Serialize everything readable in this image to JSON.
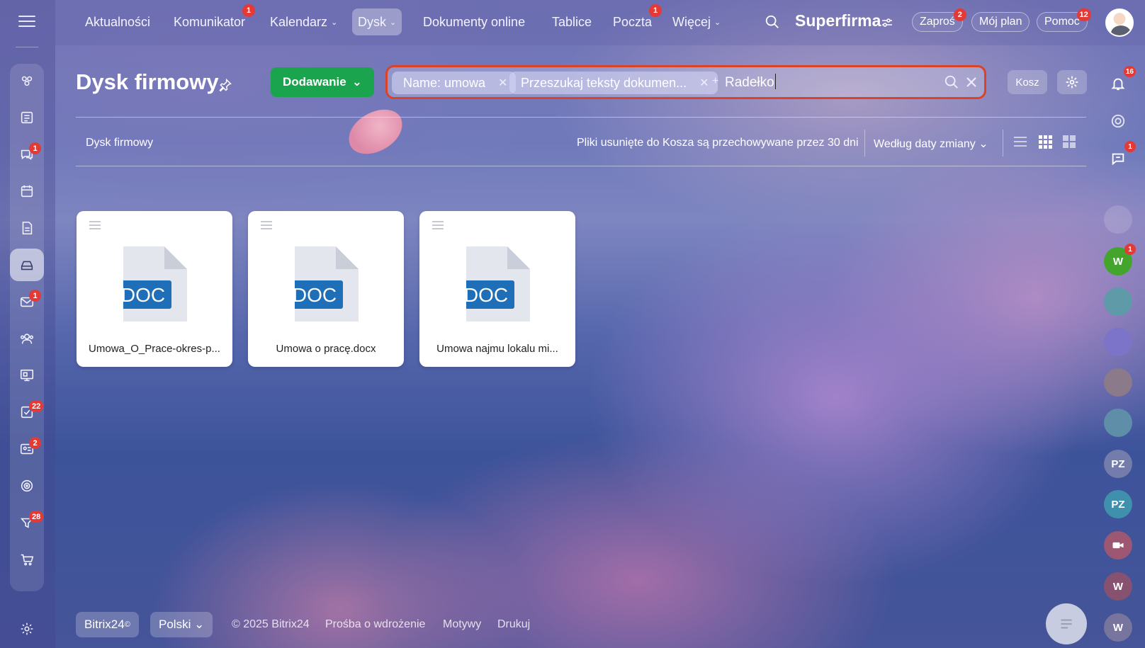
{
  "nav": {
    "items": [
      {
        "label": "Aktualności",
        "badge": ""
      },
      {
        "label": "Komunikator",
        "badge": "1"
      },
      {
        "label": "Kalendarz",
        "badge": "",
        "chevron": "⌄"
      },
      {
        "label": "Dysk",
        "badge": "",
        "chevron": "⌄"
      },
      {
        "label": "Dokumenty online",
        "badge": ""
      },
      {
        "label": "Tablice",
        "badge": ""
      },
      {
        "label": "Poczta",
        "badge": "1"
      },
      {
        "label": "Więcej",
        "badge": "",
        "chevron": "⌄"
      }
    ],
    "brand": "Superfirma",
    "invite_label": "Zaproś",
    "invite_badge": "2",
    "plan_label": "Mój plan",
    "help_label": "Pomoc",
    "help_badge": "12"
  },
  "sidebar": {
    "badges": {
      "chats": "1",
      "mail": "1",
      "tasks": "22",
      "crm": "2",
      "sites": "28"
    }
  },
  "header": {
    "title": "Dysk firmowy",
    "add_button": "Dodawanie",
    "search": {
      "chips": [
        {
          "label": "Name: umowa"
        },
        {
          "label": "Przeszukaj teksty dokumen..."
        }
      ],
      "query": "Radełko"
    },
    "trash_button": "Kosz"
  },
  "toolbar": {
    "breadcrumb": "Dysk firmowy",
    "trash_note": "Pliki usunięte do Kosza są przechowywane przez 30 dni",
    "sort_label": "Według daty zmiany"
  },
  "files": [
    {
      "name": "Umowa_O_Prace-okres-p...",
      "type": "DOC"
    },
    {
      "name": "Umowa o pracę.docx",
      "type": "DOC"
    },
    {
      "name": "Umowa najmu lokalu mi...",
      "type": "DOC"
    }
  ],
  "right_rail": {
    "notifications_badge": "16",
    "chat_badge": "1",
    "users": [
      {
        "initials": "W",
        "badge": "1",
        "color": "#43a52b"
      },
      {
        "initials": "PZ",
        "badge": "",
        "color": "#8a8fb0"
      },
      {
        "initials": "PZ",
        "badge": "",
        "color": "#3f9bb0"
      },
      {
        "initials": "W",
        "badge": "",
        "color": "#c0504d"
      },
      {
        "initials": "W",
        "badge": "",
        "color": "#9a8aa0"
      }
    ]
  },
  "footer": {
    "brand": "Bitrix24",
    "brand_mark": "©",
    "language": "Polski",
    "copyright": "© 2025 Bitrix24",
    "links": [
      "Prośba o wdrożenie",
      "Motywy",
      "Drukuj"
    ]
  },
  "colors": {
    "accent_green": "#1aa44e",
    "badge_red": "#e53935",
    "search_highlight": "#d8442a",
    "doc_blue": "#1e6fb8"
  }
}
